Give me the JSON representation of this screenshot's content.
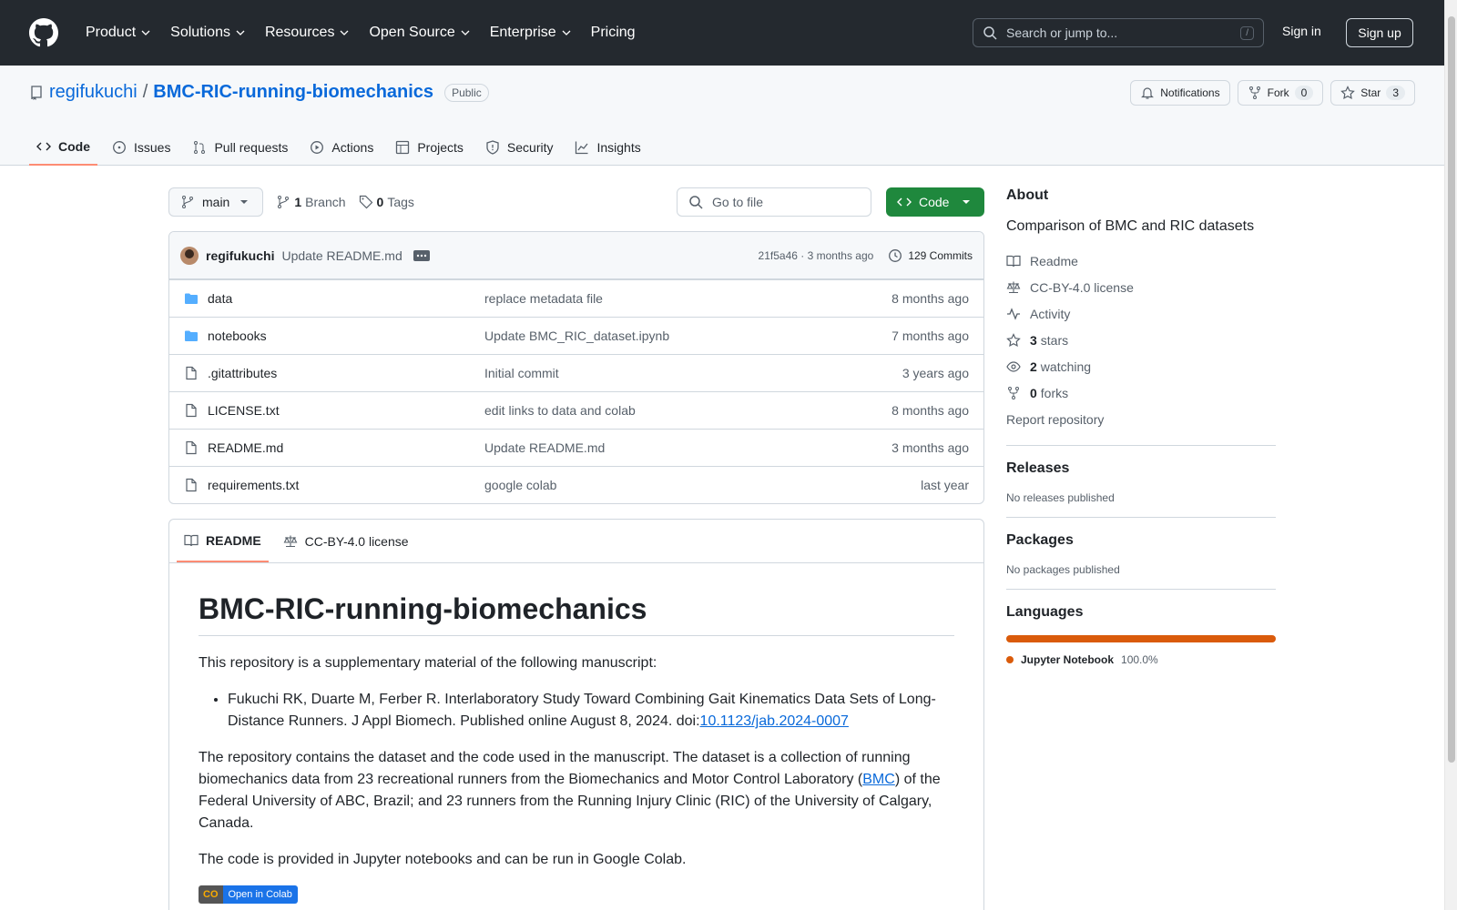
{
  "topnav": {
    "items": [
      "Product",
      "Solutions",
      "Resources",
      "Open Source",
      "Enterprise",
      "Pricing"
    ],
    "search_placeholder": "Search or jump to...",
    "search_key": "/",
    "signin": "Sign in",
    "signup": "Sign up"
  },
  "repo": {
    "owner": "regifukuchi",
    "sep": "/",
    "name": "BMC-RIC-running-biomechanics",
    "visibility": "Public",
    "notifications": "Notifications",
    "fork_label": "Fork",
    "fork_count": "0",
    "star_label": "Star",
    "star_count": "3"
  },
  "tabs": [
    "Code",
    "Issues",
    "Pull requests",
    "Actions",
    "Projects",
    "Security",
    "Insights"
  ],
  "toolbar": {
    "branch": "main",
    "branch_count": "1",
    "branch_label": "Branch",
    "tag_count": "0",
    "tag_label": "Tags",
    "goto_placeholder": "Go to file",
    "code_btn": "Code"
  },
  "commit": {
    "author": "regifukuchi",
    "message": "Update README.md",
    "hash_time": "21f5a46 · 3 months ago",
    "commits_label": "129 Commits"
  },
  "files": [
    {
      "name": "data",
      "type": "folder",
      "message": "replace metadata file",
      "date": "8 months ago"
    },
    {
      "name": "notebooks",
      "type": "folder",
      "message": "Update BMC_RIC_dataset.ipynb",
      "date": "7 months ago"
    },
    {
      "name": ".gitattributes",
      "type": "file",
      "message": "Initial commit",
      "date": "3 years ago"
    },
    {
      "name": "LICENSE.txt",
      "type": "file",
      "message": "edit links to data and colab",
      "date": "8 months ago"
    },
    {
      "name": "README.md",
      "type": "file",
      "message": "Update README.md",
      "date": "3 months ago"
    },
    {
      "name": "requirements.txt",
      "type": "file",
      "message": "google colab",
      "date": "last year"
    }
  ],
  "readme": {
    "tab_readme": "README",
    "tab_license": "CC-BY-4.0 license",
    "title": "BMC-RIC-running-biomechanics",
    "intro": "This repository is a supplementary material of the following manuscript:",
    "citation": "Fukuchi RK, Duarte M, Ferber R. Interlaboratory Study Toward Combining Gait Kinematics Data Sets of Long-Distance Runners. J Appl Biomech. Published online August 8, 2024. doi:",
    "doi": "10.1123/jab.2024-0007",
    "para2_a": "The repository contains the dataset and the code used in the manuscript. The dataset is a collection of running biomechanics data from 23 recreational runners from the Biomechanics and Motor Control Laboratory (",
    "para2_link": "BMC",
    "para2_b": ") of the Federal University of ABC, Brazil; and 23 runners from the Running Injury Clinic (RIC) of the University of Calgary, Canada.",
    "para3": "The code is provided in Jupyter notebooks and can be run in Google Colab.",
    "badge_logo": "CO",
    "badge_text": "Open in Colab"
  },
  "about": {
    "heading": "About",
    "description": "Comparison of BMC and RIC datasets",
    "readme": "Readme",
    "license": "CC-BY-4.0 license",
    "activity": "Activity",
    "stars_count": "3",
    "stars_label": "stars",
    "watching_count": "2",
    "watching_label": "watching",
    "forks_count": "0",
    "forks_label": "forks",
    "report": "Report repository"
  },
  "releases": {
    "heading": "Releases",
    "empty": "No releases published"
  },
  "packages": {
    "heading": "Packages",
    "empty": "No packages published"
  },
  "languages": {
    "heading": "Languages",
    "items": [
      {
        "name": "Jupyter Notebook",
        "pct": "100.0%",
        "color": "#DA5B0B"
      }
    ]
  },
  "colors": {
    "header": "#24292f",
    "link": "#0969da",
    "primary": "#1f883d",
    "tab_underline": "#fd8c73"
  }
}
